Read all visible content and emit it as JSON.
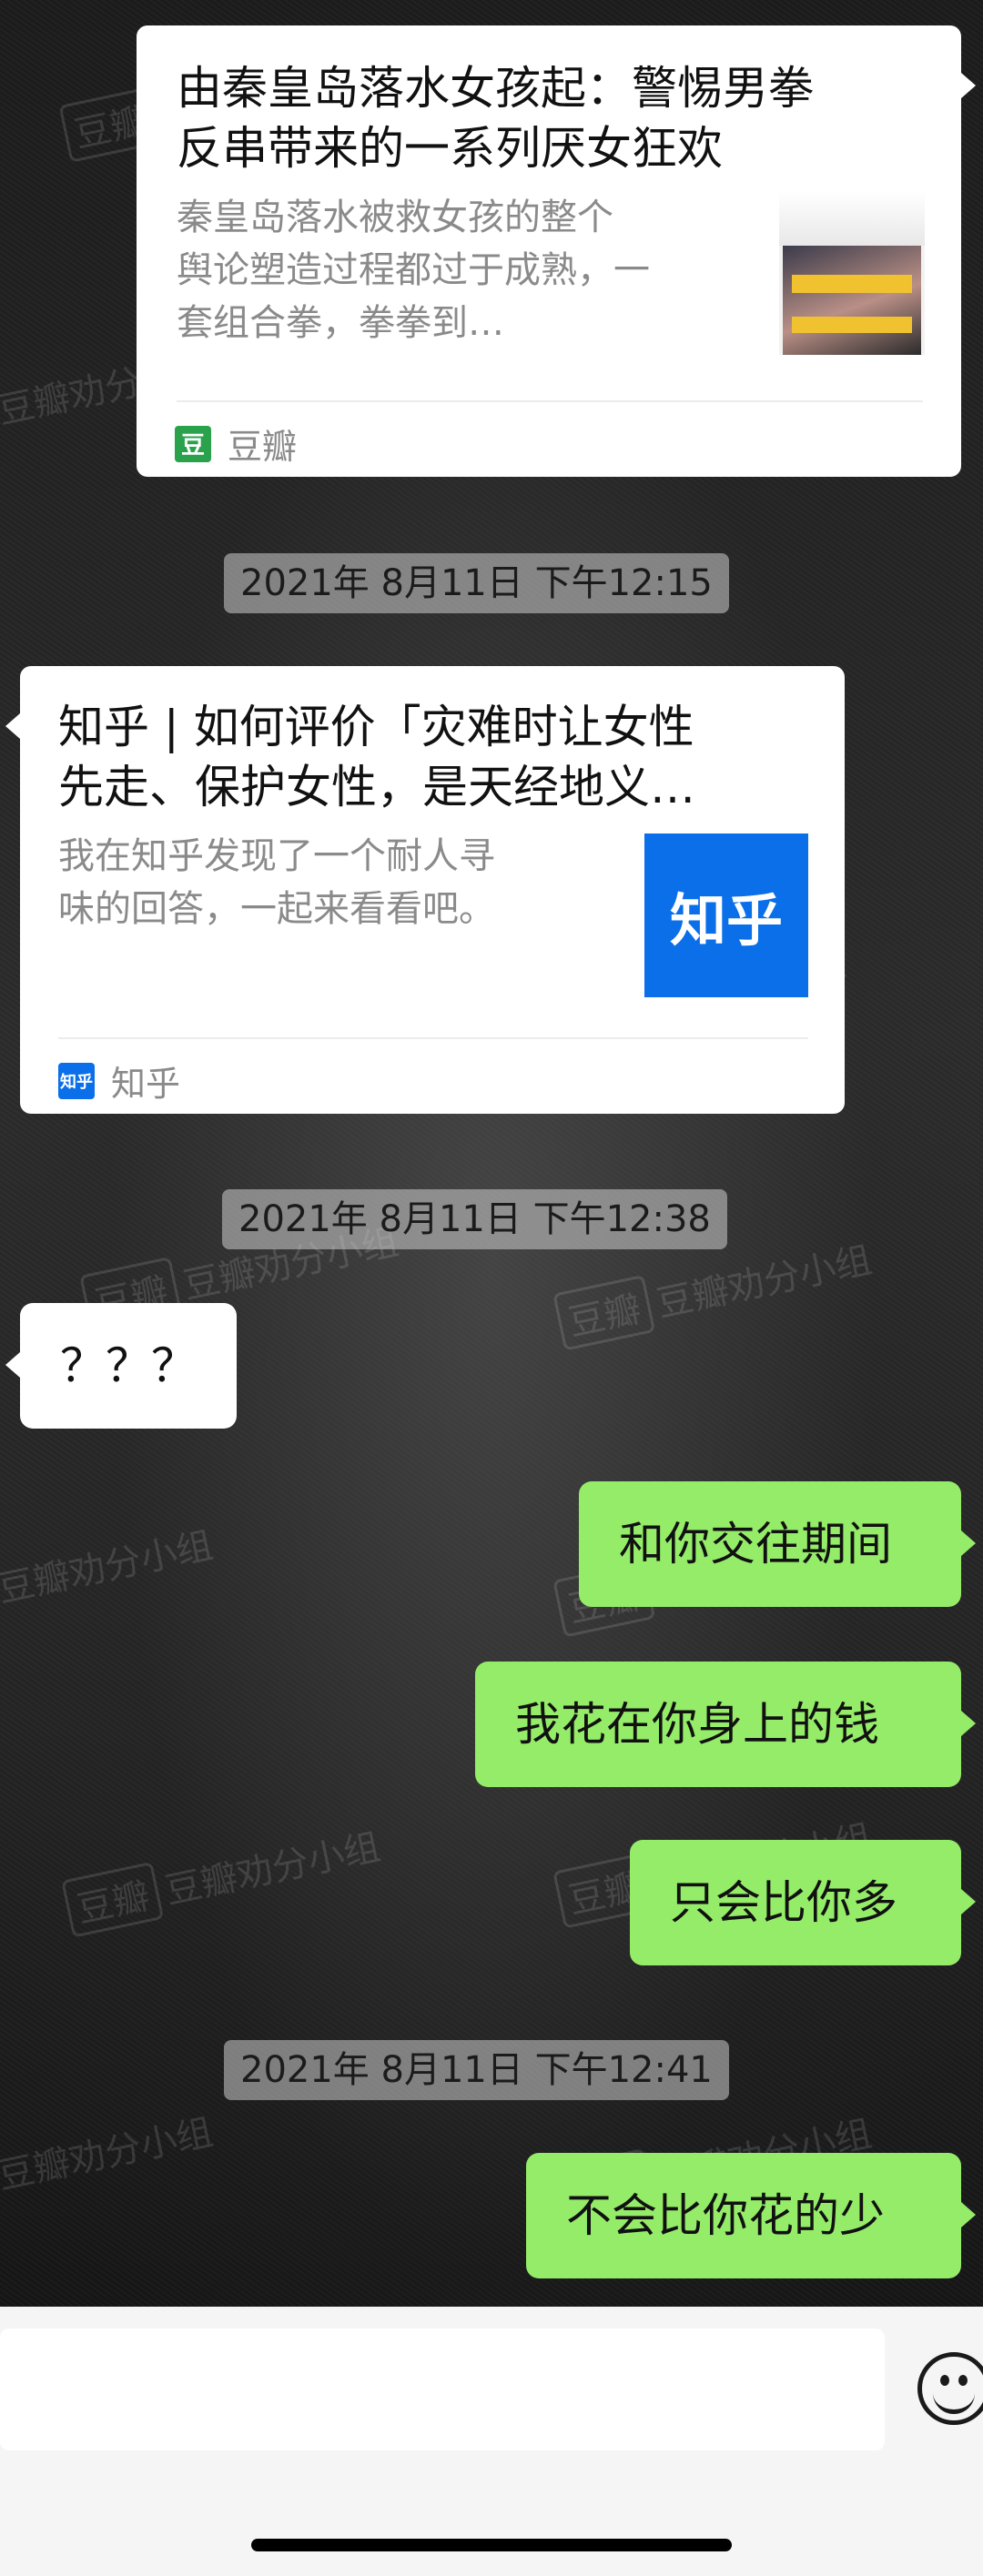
{
  "link_cards": [
    {
      "title_line1": "由秦皇岛落水女孩起：警惕男拳",
      "title_line2": "反串带来的一系列厌女狂欢",
      "desc_line1": "秦皇岛落水被救女孩的整个",
      "desc_line2": "舆论塑造过程都过于成熟，一",
      "desc_line3": "套组合拳，拳拳到…",
      "source_name": "豆瓣",
      "source_icon_text": "豆",
      "source_icon_color": "#2aa24c",
      "direction": "outgoing"
    },
    {
      "title_line1": "知乎 | 如何评价「灾难时让女性",
      "title_line2": "先走、保护女性，是天经地义…",
      "desc_line1": "我在知乎发现了一个耐人寻",
      "desc_line2": "味的回答，一起来看看吧。",
      "thumb_text": "知乎",
      "thumb_color": "#0a6fe8",
      "source_name": "知乎",
      "source_icon_text": "知乎",
      "source_icon_color": "#0a6fe8",
      "direction": "incoming"
    }
  ],
  "timestamps": [
    "2021年 8月11日 下午12:15",
    "2021年 8月11日 下午12:38",
    "2021年 8月11日 下午12:41"
  ],
  "messages": [
    {
      "text": "？？？",
      "direction": "incoming"
    },
    {
      "text": "和你交往期间",
      "direction": "outgoing"
    },
    {
      "text": "我花在你身上的钱",
      "direction": "outgoing"
    },
    {
      "text": "只会比你多",
      "direction": "outgoing"
    },
    {
      "text": "不会比你花的少",
      "direction": "outgoing"
    }
  ],
  "watermark": {
    "box": "豆瓣",
    "text": "豆瓣劝分小组"
  },
  "colors": {
    "outgoing_bubble": "#95ec69",
    "incoming_bubble": "#ffffff",
    "input_bar": "#f5f5f5"
  },
  "input_bar": {
    "icon": "emoji-icon"
  }
}
